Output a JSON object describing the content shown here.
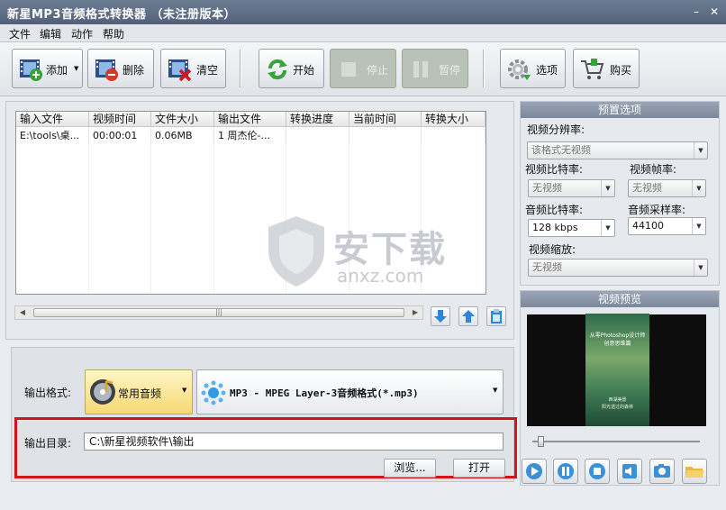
{
  "window": {
    "title": "新星MP3音频格式转换器 （未注册版本）",
    "minimize_glyph": "–",
    "close_glyph": "✕"
  },
  "menu": [
    "文件",
    "编辑",
    "动作",
    "帮助"
  ],
  "toolbar": {
    "add": "添加",
    "delete": "删除",
    "clear": "清空",
    "start": "开始",
    "stop": "停止",
    "pause": "暂停",
    "options": "选项",
    "buy": "购买"
  },
  "table": {
    "columns": [
      "输入文件",
      "视频时间",
      "文件大小",
      "输出文件",
      "转换进度",
      "当前时间",
      "转换大小"
    ],
    "rows": [
      [
        "E:\\tools\\桌...",
        "00:00:01",
        "0.06MB",
        "1 周杰伦-...",
        "",
        "",
        ""
      ]
    ]
  },
  "watermark": {
    "text": "安下载",
    "sub": "anxz.com"
  },
  "scroll_grip": "|||",
  "output": {
    "format_label": "输出格式:",
    "format_category": "常用音频",
    "format_value": "MP3 - MPEG Layer-3音频格式(*.mp3)",
    "dir_label": "输出目录:",
    "dir_value": "C:\\新星视频软件\\输出",
    "browse": "浏览...",
    "open": "打开"
  },
  "preset": {
    "header": "预置选项",
    "video_resolution_label": "视频分辨率:",
    "video_resolution_value": "该格式无视频",
    "video_bitrate_label": "视频比特率:",
    "video_bitrate_value": "无视频",
    "video_fps_label": "视频帧率:",
    "video_fps_value": "无视频",
    "audio_bitrate_label": "音频比特率:",
    "audio_bitrate_value": "128 kbps",
    "audio_samplerate_label": "音频采样率:",
    "audio_samplerate_value": "44100",
    "video_scale_label": "视频缩放:",
    "video_scale_value": "无视频"
  },
  "preview": {
    "header": "视频预览",
    "frame_lines": [
      "从零Photoshop设计师",
      "创意思维篇",
      "西湖美景",
      "阳光透过的森林"
    ]
  }
}
